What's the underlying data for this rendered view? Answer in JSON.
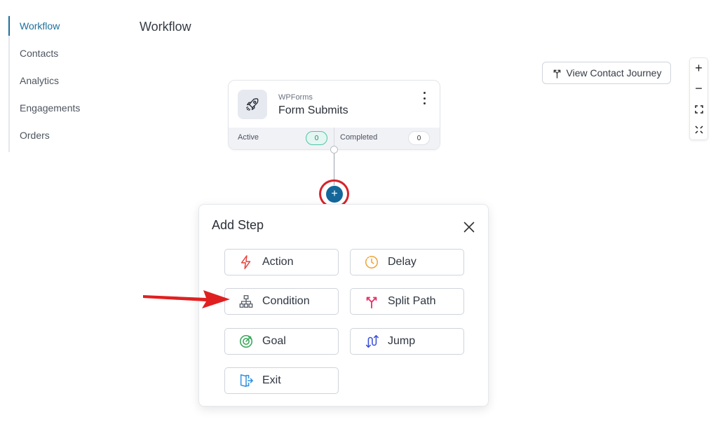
{
  "sidebar": {
    "items": [
      {
        "label": "Workflow",
        "active": true
      },
      {
        "label": "Contacts",
        "active": false
      },
      {
        "label": "Analytics",
        "active": false
      },
      {
        "label": "Engagements",
        "active": false
      },
      {
        "label": "Orders",
        "active": false
      }
    ]
  },
  "header": {
    "title": "Workflow"
  },
  "toolbar": {
    "journey_label": "View Contact Journey",
    "journey_icon": "split-branch-icon",
    "zoom_in_label": "+",
    "zoom_out_label": "−"
  },
  "node": {
    "source": "WPForms",
    "title": "Form Submits",
    "icon": "rocket-icon",
    "stats": {
      "active_label": "Active",
      "active_count": "0",
      "completed_label": "Completed",
      "completed_count": "0"
    }
  },
  "add_button": {
    "label": "+"
  },
  "modal": {
    "title": "Add Step",
    "options": [
      {
        "label": "Action",
        "icon": "lightning-icon",
        "color": "#e8413b"
      },
      {
        "label": "Delay",
        "icon": "clock-icon",
        "color": "#f0a030"
      },
      {
        "label": "Condition",
        "icon": "hierarchy-icon",
        "color": "#555b66"
      },
      {
        "label": "Split Path",
        "icon": "split-path-icon",
        "color": "#e8326a"
      },
      {
        "label": "Goal",
        "icon": "target-icon",
        "color": "#3aa65a"
      },
      {
        "label": "Jump",
        "icon": "jump-icon",
        "color": "#3b4fd8"
      },
      {
        "label": "Exit",
        "icon": "exit-door-icon",
        "color": "#2f8fe0"
      }
    ]
  },
  "colors": {
    "accent": "#13679a",
    "highlight": "#d6232a",
    "active_badge": "#4cc7a6"
  }
}
